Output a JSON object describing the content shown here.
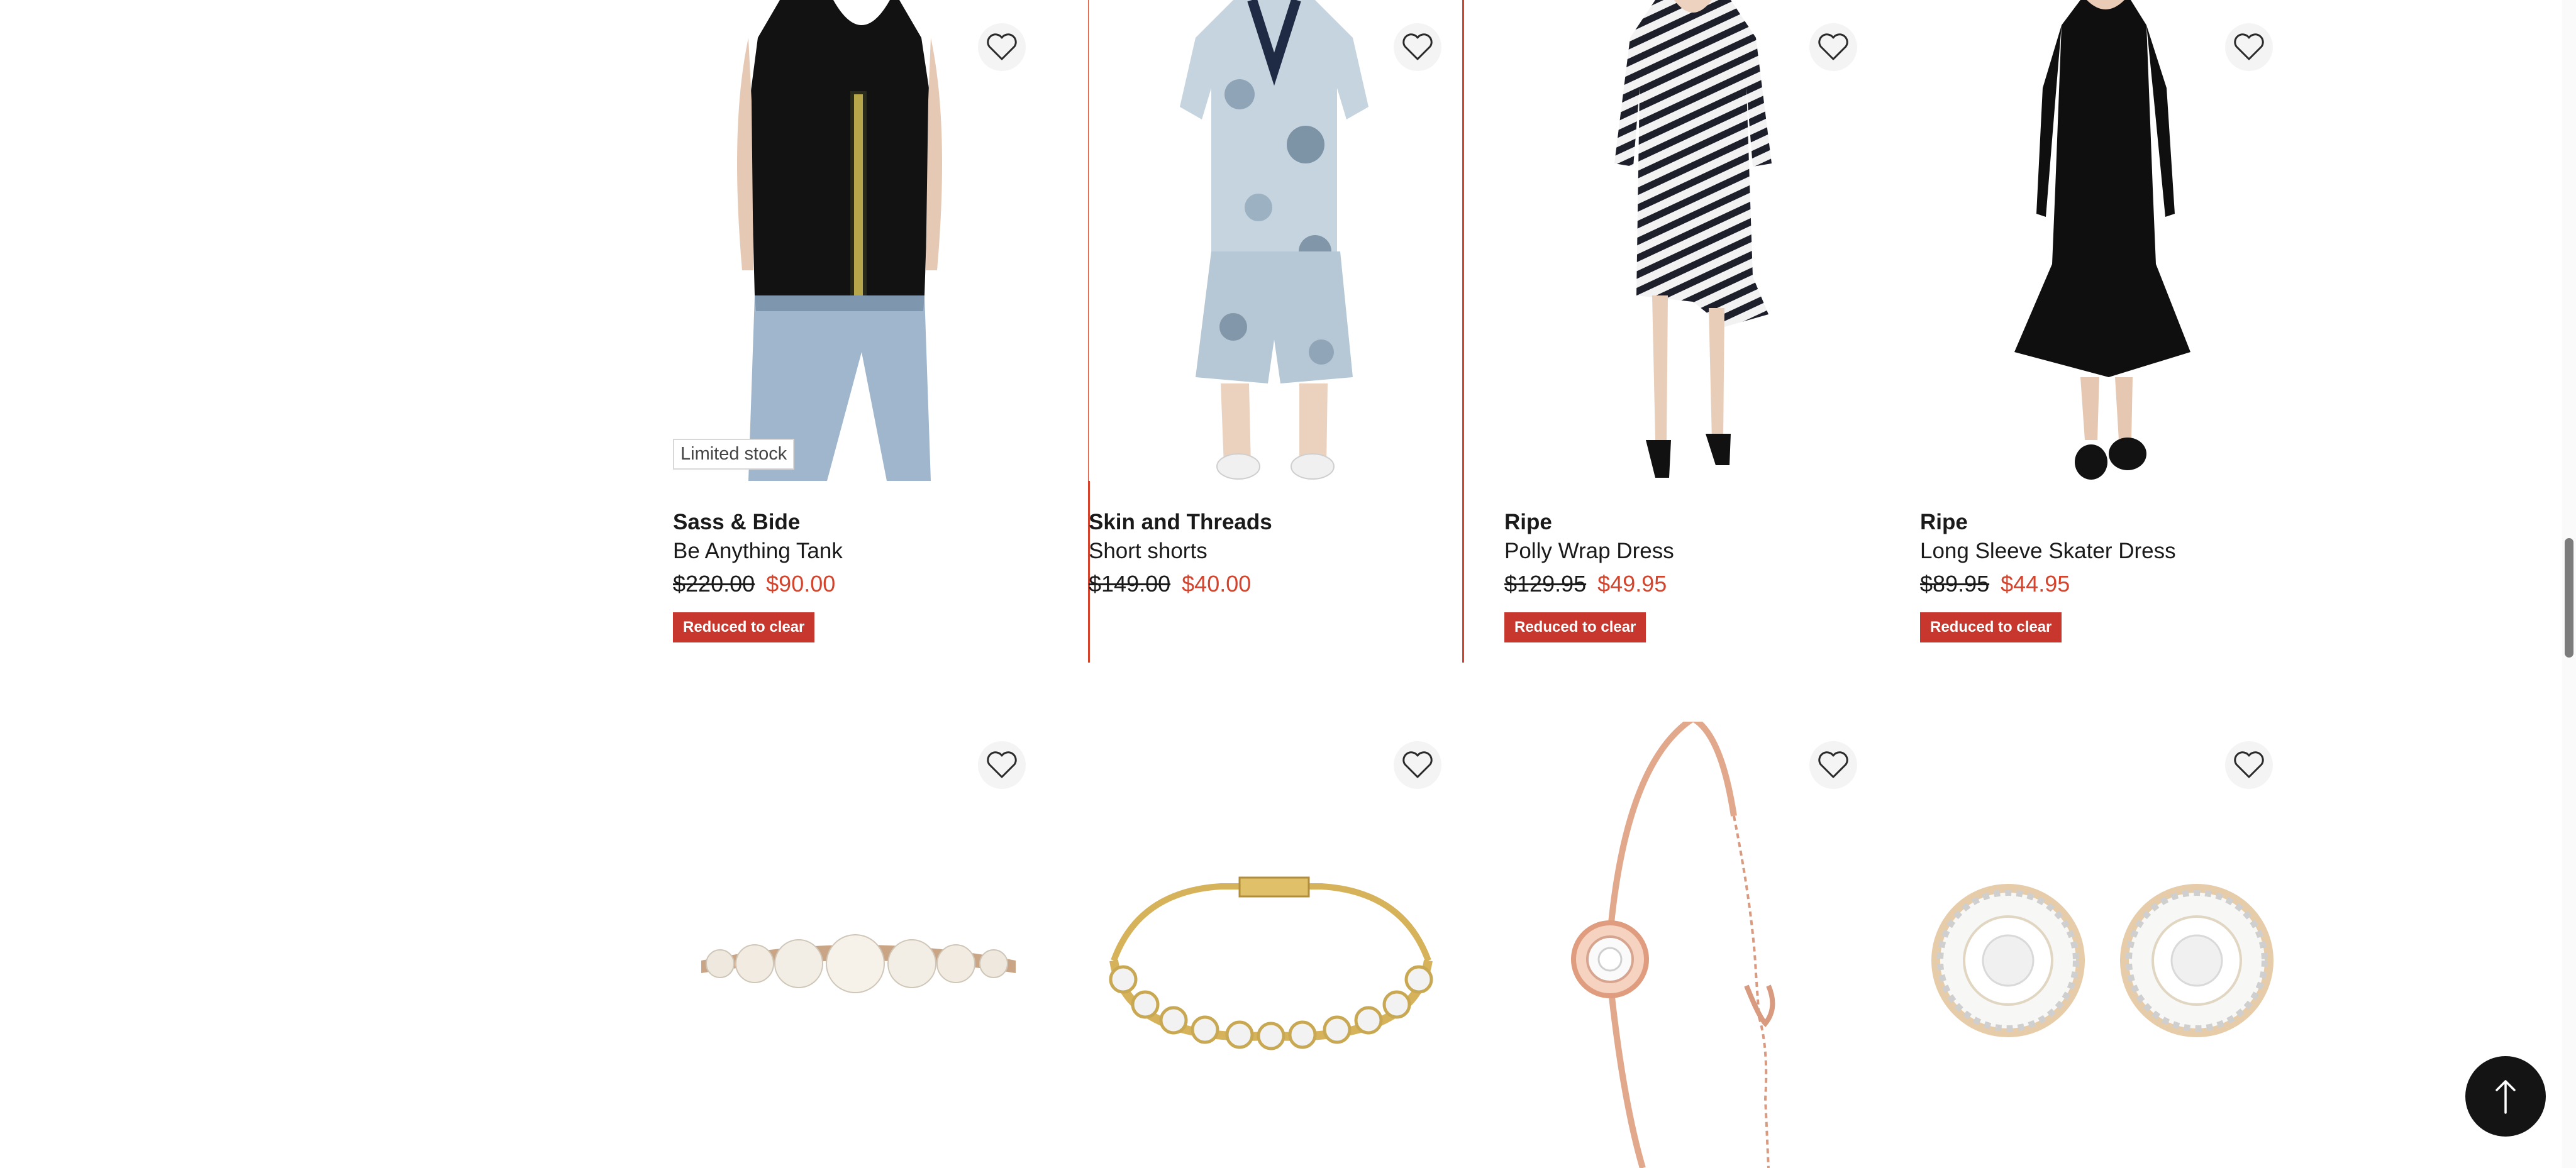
{
  "row1": [
    {
      "brand": "Sass & Bide",
      "name": "Be Anything Tank",
      "was_price": "$220.00",
      "now_price": "$90.00",
      "badge": "Limited stock",
      "tag": "Reduced to clear",
      "image": "black sleeveless tank with embellished stripe, worn with light denim jeans"
    },
    {
      "brand": "Skin and Threads",
      "name": "Short shorts",
      "was_price": "$149.00",
      "now_price": "$40.00",
      "tag": "",
      "image": "blue floral print v-neck top and matching shorts set, white sneakers"
    },
    {
      "brand": "Ripe",
      "name": "Polly Wrap Dress",
      "was_price": "$129.95",
      "now_price": "$49.95",
      "tag": "Reduced to clear",
      "image": "black and white striped wrap dress, black heeled sandals"
    },
    {
      "brand": "Ripe",
      "name": "Long Sleeve Skater Dress",
      "was_price": "$89.95",
      "now_price": "$44.95",
      "tag": "Reduced to clear",
      "image": "black long sleeve skater dress, black loafers"
    }
  ],
  "row2": [
    {
      "image": "pearl hair clip with graduated pearls"
    },
    {
      "image": "gold crystal tennis bracelet"
    },
    {
      "image": "rose gold bangle with crystal halo pendant and chain"
    },
    {
      "image": "gold halo crystal stud earrings"
    }
  ],
  "icons": {
    "wishlist": "heart-outline-icon",
    "back_to_top": "arrow-up-icon"
  },
  "colors": {
    "sale_price": "#d4442c",
    "tag_bg": "#c8372d",
    "highlight_border": "#d4442c",
    "to_top_bg": "#141414"
  }
}
